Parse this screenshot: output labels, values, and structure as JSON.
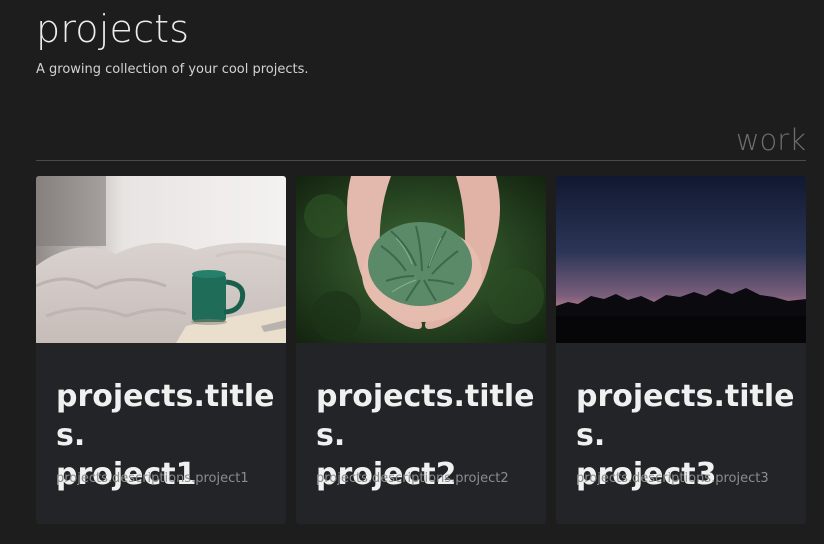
{
  "header": {
    "title": "projects",
    "subtitle": "A growing collection of your cool projects."
  },
  "section": {
    "label": "work"
  },
  "projects": [
    {
      "title_line1": "projects.titles.",
      "title_line2": "project1",
      "description": "projects.descriptions.project1",
      "image_icon": "coffee-mug-photo"
    },
    {
      "title_line1": "projects.titles.",
      "title_line2": "project2",
      "description": "projects.descriptions.project2",
      "image_icon": "hands-holding-pine-photo"
    },
    {
      "title_line1": "projects.titles.",
      "title_line2": "project3",
      "description": "projects.descriptions.project3",
      "image_icon": "mountain-sunset-photo"
    }
  ],
  "colors": {
    "background": "#1d1d1d",
    "card_background": "#222427",
    "section_label": "#6e6e6e",
    "description_text": "#8c8c8c"
  }
}
